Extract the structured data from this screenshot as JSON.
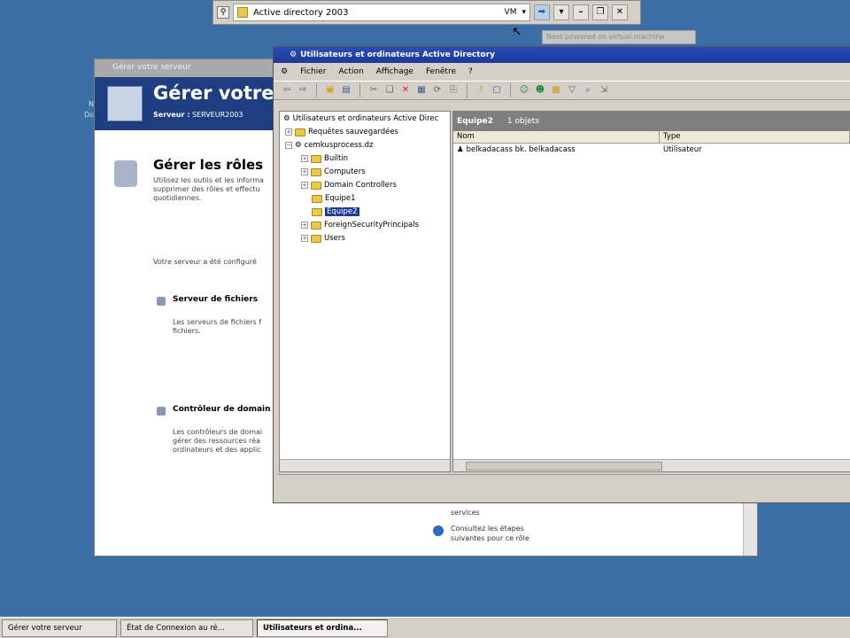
{
  "vm_bar": {
    "title": "Active directory 2003",
    "vm_label": "VM",
    "tooltip": "Next powered on virtual machine"
  },
  "desktop": {
    "icon_label": "N\nDo"
  },
  "manage_window": {
    "titlebar": "Gérer votre serveur",
    "banner_title": "Gérer votre",
    "server_prefix": "Serveur :",
    "server_name": "SERVEUR2003",
    "roles_heading": "Gérer les rôles",
    "roles_desc": "Utilisez les outils et les informa\nsupprimer des rôles et effectu\nquotidiennes.",
    "configured_text": "Votre serveur a été configuré",
    "file_server_title": "Serveur de fichiers",
    "file_server_desc": "Les serveurs de fichiers f\nfichiers.",
    "domain_controller_title": "Contrôleur de domain",
    "domain_controller_desc": "Les contrôleurs de domai\ngérer des ressources réa\nordinateurs et des applic",
    "link_services": "services",
    "link_next_steps": "Consultez les étapes\nsuivantes pour ce rôle"
  },
  "ad_window": {
    "title": "Utilisateurs et ordinateurs Active Directory",
    "menu": [
      "Fichier",
      "Action",
      "Affichage",
      "Fenêtre",
      "?"
    ],
    "tree": [
      "Utilisateurs et ordinateurs Active Direc",
      "Requêtes sauvegardées",
      "cemkusprocess.dz",
      "Builtin",
      "Computers",
      "Domain Controllers",
      "Equipe1",
      "Equipe2",
      "ForeignSecurityPrincipals",
      "Users"
    ],
    "list_header": "Equipe2",
    "list_count": "1 objets",
    "columns": [
      "Nom",
      "Type"
    ],
    "rows": [
      {
        "name": "belkadacass bk. belkadacass",
        "type": "Utilisateur"
      }
    ]
  },
  "taskbar": {
    "items": [
      "Gérer votre serveur",
      "État de Connexion au ré...",
      "Utilisateurs et ordina..."
    ]
  }
}
